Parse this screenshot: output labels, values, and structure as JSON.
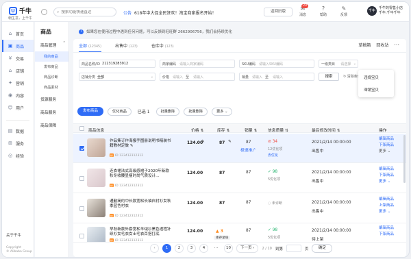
{
  "app": {
    "logo_text": "千牛",
    "logo_sub": "朝生意，上千牛",
    "search_placeholder": "搜索功能快速直达",
    "notice_tag": "公告",
    "notice_text": "618年中大促全民狂欢！淘宝商家报名开始！",
    "back_old": "返回旧版",
    "top_icons": [
      {
        "name": "message-icon",
        "label": "消息",
        "badge": "20"
      },
      {
        "name": "help-icon",
        "label": "帮助",
        "badge": ""
      },
      {
        "name": "feedback-icon",
        "label": "反馈",
        "badge": ""
      }
    ],
    "user": {
      "avatar": "千牛",
      "shop": "千牛的零售小店",
      "account": "千牛:千牛千牛"
    }
  },
  "sidebar": {
    "items": [
      {
        "label": "首页",
        "icon": "home-icon",
        "glyph": "⌂"
      },
      {
        "label": "商品",
        "icon": "goods-icon",
        "glyph": "▣"
      },
      {
        "label": "交易",
        "icon": "trade-icon",
        "glyph": "¥"
      },
      {
        "label": "店铺",
        "icon": "shop-icon",
        "glyph": "⌂"
      },
      {
        "label": "营销",
        "icon": "marketing-icon",
        "glyph": "✦"
      },
      {
        "label": "内容",
        "icon": "content-icon",
        "glyph": "◉"
      },
      {
        "label": "用户",
        "icon": "user-icon",
        "glyph": "☺"
      },
      {
        "label": "数据",
        "icon": "data-icon",
        "glyph": "▤"
      },
      {
        "label": "服务",
        "icon": "service-icon",
        "glyph": "⊞"
      },
      {
        "label": "经验",
        "icon": "experience-icon",
        "glyph": "◎"
      }
    ],
    "about": "关于千牛",
    "copyright_1": "Copyright",
    "copyright_2": "© Alibaba Group"
  },
  "subnav": {
    "title": "商品",
    "group1": "商品管理",
    "group1_items": [
      "我的商品",
      "发布商品",
      "商品诊断",
      "商品素材"
    ],
    "group2": "货源服务",
    "group3": "商品服务",
    "group4": "商品保障"
  },
  "tip": "如果您在使用过程中遇到任何问题，可以反馈到旺旺群 2662906756，我们会持续优化",
  "tabs": [
    {
      "label": "全部",
      "count": "(12345)"
    },
    {
      "label": "出售中",
      "count": "(123)"
    },
    {
      "label": "仓库中",
      "count": "(123)"
    }
  ],
  "toolbar": {
    "draft": "草稿箱",
    "recycle": "回收站",
    "more": "···"
  },
  "dropdown": [
    "违规宝贝",
    "滞销宝贝"
  ],
  "filters": {
    "id_label": "商品名称/ID",
    "id_value": "212319283912",
    "code_label": "商家编码",
    "code_ph": "请输入商家编码",
    "sku_label": "SKU编码",
    "sku_ph": "请输入SKU编码",
    "cat1_label": "一级类目",
    "cat1_ph": "请选择",
    "cat_label": "店铺分类",
    "cat_value": "全部",
    "price_label": "价格",
    "price_from": "请输入",
    "price_to": "请输入",
    "to": "至",
    "sales_label": "销量",
    "sales_from": "请输入",
    "sales_to": "请输入",
    "search": "搜索",
    "clear": "清除条件"
  },
  "actions": {
    "publish": "发布商品",
    "publish_badge": "新",
    "optimize": "优化商品",
    "selected": "已选 1",
    "batch_delete": "批量删除",
    "batch_edit": "批量删除",
    "more": "更多"
  },
  "table": {
    "headers": [
      "商品信息",
      "价格",
      "库存",
      "销量",
      "信息质量",
      "最后修改时间",
      "操作"
    ],
    "rows": [
      {
        "title": "作品集订作海报手图册说明书精装书籍教材定做",
        "id": "ID 123412312312",
        "price": "124.00",
        "stock": "87",
        "sales": "87",
        "sales_link": "极速推广",
        "score": "34",
        "score_note": "12优化项",
        "score_link": "去优化",
        "time": "2021/2/14 00:00:00",
        "status": "出售中",
        "ops": [
          "编辑商品",
          "下架商品",
          "更多"
        ]
      },
      {
        "title": "连衣裙法式高级感裙子2020年新款秋冬收腰显瘦时尚气质设计...",
        "id": "ID 123412312312",
        "price": "124.00",
        "stock": "87",
        "sales": "87",
        "sales_link": "",
        "score": "98",
        "score_note": "5优化项",
        "score_link": "",
        "time": "2021/2/14 00:00:00",
        "status": "出售中",
        "ops": [
          "编辑商品",
          "下架商品",
          "更多"
        ]
      },
      {
        "title": "通勤简约中长款宽松长袖白衬衫女秋季蓝色衬衣",
        "id": "ID 123412312312",
        "price": "124.00",
        "stock": "87",
        "sales": "87",
        "sales_link": "",
        "score": "未诊断",
        "score_note": "",
        "score_link": "",
        "time": "2021/2/14 00:00:00",
        "status": "出售中",
        "ops": [
          "编辑商品",
          "上架商品",
          "更多"
        ]
      },
      {
        "title": "早秋新款外套宽松羊绒衫黑色透程针织衫女毛衣女士毛衣百搭打底",
        "id": "ID 123412312312",
        "price": "124.00",
        "stock": "3",
        "stock_tag": "库存紧张",
        "sales": "87",
        "sales_link": "",
        "score": "98",
        "score_note": "5优化项",
        "score_link": "",
        "time": "2021/2/14 00:00:00",
        "status": "待上架",
        "ops": [
          "编辑商品",
          "下架商品",
          "更多"
        ]
      }
    ]
  },
  "pager": {
    "prev": "‹",
    "pages": [
      "1",
      "2",
      "3",
      "4",
      "…",
      "10"
    ],
    "next": "下一页 ›",
    "info": "2 / 10",
    "jump_label": "到第",
    "page_unit": "页",
    "go": "确定"
  },
  "colors": {
    "accent": "#2f6cf6",
    "danger": "#f04b41",
    "success": "#23b26d",
    "warn": "#ff8a1d"
  }
}
